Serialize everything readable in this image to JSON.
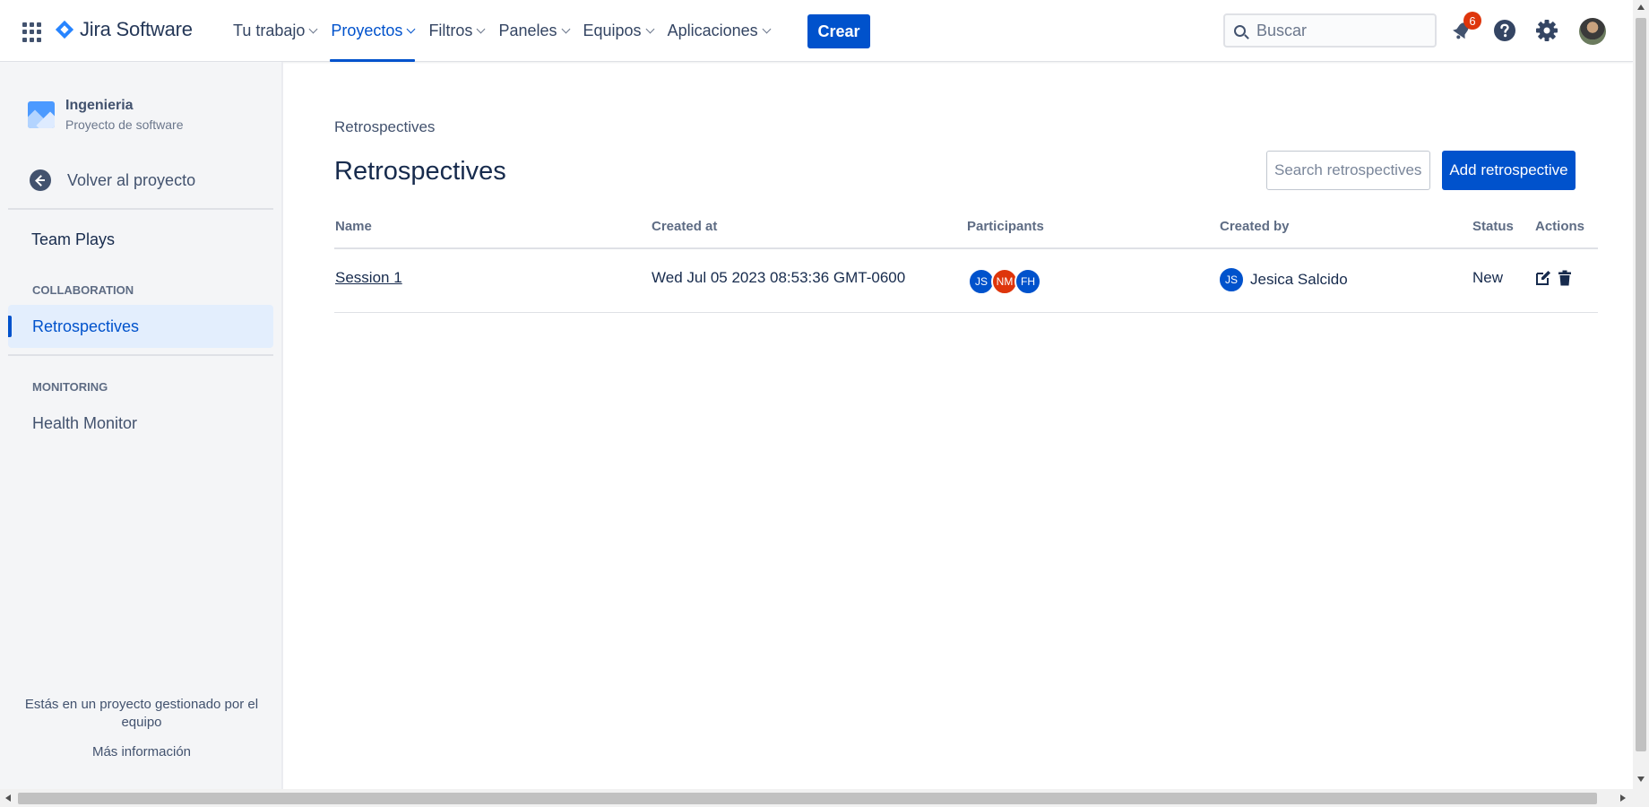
{
  "topnav": {
    "logo_text": "Jira Software",
    "items": [
      {
        "label": "Tu trabajo",
        "active": false
      },
      {
        "label": "Proyectos",
        "active": true
      },
      {
        "label": "Filtros",
        "active": false
      },
      {
        "label": "Paneles",
        "active": false
      },
      {
        "label": "Equipos",
        "active": false
      },
      {
        "label": "Aplicaciones",
        "active": false
      }
    ],
    "create_label": "Crear",
    "search_placeholder": "Buscar",
    "notification_count": "6",
    "accent_color": "#0052CC"
  },
  "sidebar": {
    "project_name": "Ingenieria",
    "project_type": "Proyecto de software",
    "back_label": "Volver al proyecto",
    "team_plays": "Team Plays",
    "section_collaboration": "COLLABORATION",
    "retrospectives": "Retrospectives",
    "section_monitoring": "MONITORING",
    "health_monitor": "Health Monitor",
    "footer_note": "Estás en un proyecto gestionado por el equipo",
    "footer_link": "Más información"
  },
  "main": {
    "breadcrumb": "Retrospectives",
    "title": "Retrospectives",
    "search_placeholder": "Search retrospectives",
    "add_label": "Add retrospective",
    "columns": {
      "name": "Name",
      "created_at": "Created at",
      "participants": "Participants",
      "created_by": "Created by",
      "status": "Status",
      "actions": "Actions"
    },
    "rows": [
      {
        "name": "Session 1",
        "created_at": "Wed Jul 05 2023 08:53:36 GMT-0600",
        "participants": [
          {
            "initials": "JS",
            "color": "#0052CC"
          },
          {
            "initials": "NM",
            "color": "#DE350B"
          },
          {
            "initials": "FH",
            "color": "#0052CC"
          }
        ],
        "created_by": {
          "initials": "JS",
          "name": "Jesica Salcido",
          "color": "#0052CC"
        },
        "status": "New"
      }
    ]
  }
}
